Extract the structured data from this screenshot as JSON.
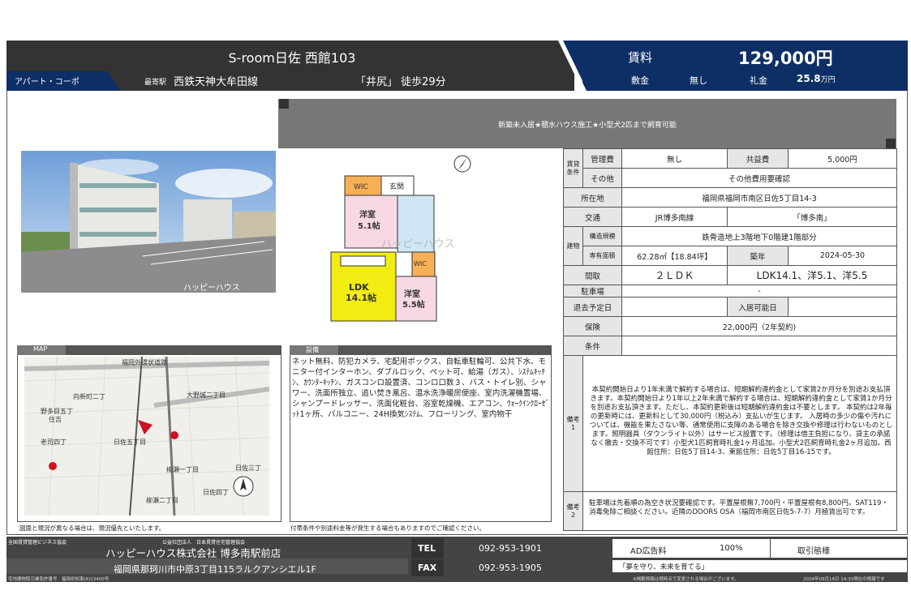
{
  "header": {
    "title": "S-room日佐 西館103",
    "type": "アパート・コーポ",
    "station_label": "最寄駅",
    "line": "西鉄天神大牟田線",
    "station": "「井尻」 徒歩29分",
    "rent_label": "賃料",
    "rent": "129,000円",
    "deposit_label": "敷金",
    "deposit": "無し",
    "key_money_label": "礼金",
    "key_money": "25.8",
    "key_money_unit": "万円"
  },
  "banner": "新築未入居★積水ハウス施工★小型犬2匹まで飼育可能",
  "photo_watermark": "ハッピーハウス",
  "floorplan": {
    "wic1": "WIC",
    "entrance": "玄関",
    "room1": "洋室",
    "room1_size": "5.1帖",
    "wic2": "WIC",
    "ldk": "LDK",
    "ldk_size": "14.1帖",
    "room2": "洋室",
    "room2_size": "5.5帖",
    "watermark": "ハッピーハウス"
  },
  "spec": {
    "cond_label": "賃貸条件",
    "mgmt_label": "管理費",
    "mgmt": "無し",
    "common_label": "共益費",
    "common": "5,000円",
    "other_label": "その他",
    "other": "その他費用要確認",
    "address_label": "所在地",
    "address": "福岡県福岡市南区日佐5丁目14-3",
    "transport_label": "交通",
    "transport_line": "JR博多南線",
    "transport_station": "「博多南」",
    "building_label": "建物",
    "structure_label": "構造規模",
    "structure": "鉄骨造地上3階地下0階建1階部分",
    "area_label": "専有面積",
    "area": "62.28㎡【18.84坪】",
    "built_label": "築年",
    "built": "2024-05-30",
    "layout_label": "間取",
    "layout": "２ＬＤＫ",
    "layout_detail": "LDK14.1、洋5.1、洋5.5",
    "parking_label": "駐車場",
    "parking": "-",
    "vacate_label": "退去予定日",
    "vacate": "",
    "movein_label": "入居可能日",
    "movein": "",
    "insurance_label": "保険",
    "insurance": "22,000円（2年契約)",
    "conditions_label": "条件",
    "conditions": "",
    "remark1_label": "備考1",
    "remark1": "本契約開始日より1年未満で解約する場合は、短期解約違約金として家賃2か月分を別途お支払頂きます。本契約開始日より1年以上2年未満で解約する場合は、短期解約違約金として家賃1か月分を別途お支払頂きます。ただし、本契約更新後は短期解約違約金は不要とします。 本契約は2年毎の更新時には、更新料として30,000円（税込み）支払いが生じます。 入居時の多少の傷や汚れについては、機能を果たさない等、通常使用に支障のある場合を除き交換や修理は行わないものとします。照明器具（ダウンライト以外）はサービス設置です。（修理は借主負担になり、貸主の承諾なく撤去・交換不可です）小型犬1匹飼育時礼金1ヶ月追加。小型犬2匹飼育時礼金2ヶ月追加。西館住所：日佐5丁目14-3、東館住所：日佐5丁目16-15です。",
    "remark2_label": "備考2",
    "remark2": "駐車場は先着順の為空き状況要確認です。平置屋根無7,700円・平置屋根有8,800円。SAT119・消毒免除ご相談ください。近隣のDOORS OSA（福岡市南区日佐5-7-7）月極賃出可です。"
  },
  "map": {
    "label": "MAP",
    "note": "図面と現況が異なる場合は、現況優先といたします。",
    "places": [
      "福岡外環状道路",
      "向新町二丁",
      "野多目五丁",
      "住吉",
      "老司四丁",
      "日佐五丁目",
      "柳瀬一丁目",
      "柳瀬二丁目",
      "大野城二丁目",
      "日佐三丁",
      "日佐四丁"
    ]
  },
  "facilities": {
    "label": "設備",
    "text": "ネット無料、防犯カメラ、宅配用ボックス、自転車駐輪可、公共下水、モニター付インターホン、ダブルロック、ペット可、給湯（ガス）、ｼｽﾃﾑｷｯﾁﾝ、ｶｳﾝﾀｰｷｯﾁﾝ、ガスコンロ設置済、コンロ口数３、バス・トイレ別、シャワー、洗面所独立、追い焚き風呂、温水洗浄暖房便座、室内洗濯機置場、シャンプードレッサー、洗面化粧台、浴室乾燥機、エアコン、ｳｫｰｸｲﾝｸﾛｰｾﾞｯﾄ1ヶ所、バルコニー、24H換気ｼｽﾃﾑ、フローリング、室内物干",
    "fee_note": "付帯条件や別途料金等が発生する場合もありますのでご確認ください。"
  },
  "footer": {
    "assoc1": "全国賃貸管理ビジネス協会",
    "assoc2": "公益社団法人　日本賃貸住宅管理協会",
    "company": "ハッピーハウス株式会社 博多南駅前店",
    "address": "福岡県那珂川市中原3丁目115ラルクアンシエル1F",
    "tel_label": "TEL",
    "tel": "092-953-1901",
    "fax_label": "FAX",
    "fax": "092-953-1905",
    "ad_label": "AD広告料",
    "ad_value": "100%",
    "trade_label": "取引態様",
    "trade": "",
    "slogan": "「夢を守り、未来を育てる」",
    "license": "宅地建物取引業免許番号　福岡県知事(6)13400号",
    "disclaimer": "※掲載情報は現時点で変更される場合がございます。",
    "timestamp": "2024年09月18日 14:33現在の情報です"
  }
}
